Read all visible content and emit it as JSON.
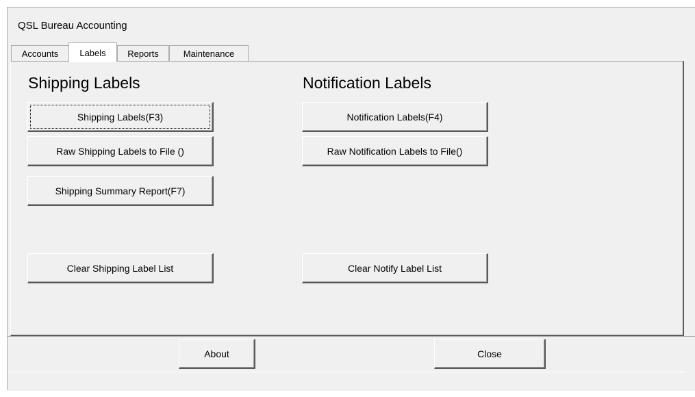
{
  "window": {
    "title": "QSL Bureau Accounting"
  },
  "tabs": [
    {
      "label": "Accounts",
      "selected": false
    },
    {
      "label": "Labels",
      "selected": true
    },
    {
      "label": "Reports",
      "selected": false
    },
    {
      "label": "Maintenance",
      "selected": false
    }
  ],
  "labels_tab": {
    "shipping": {
      "heading": "Shipping Labels",
      "shipping_labels_button": "Shipping  Labels(F3)",
      "raw_shipping_button": "Raw Shipping  Labels to File ()",
      "summary_report_button": "Shipping Summary Report(F7)",
      "clear_button": "Clear Shipping Label List"
    },
    "notification": {
      "heading": "Notification Labels",
      "notification_labels_button": "Notification  Labels(F4)",
      "raw_notification_button": "Raw  Notification  Labels to File()",
      "clear_button": "Clear Notify Label List"
    }
  },
  "footer": {
    "about_button": "About",
    "close_button": "Close"
  }
}
